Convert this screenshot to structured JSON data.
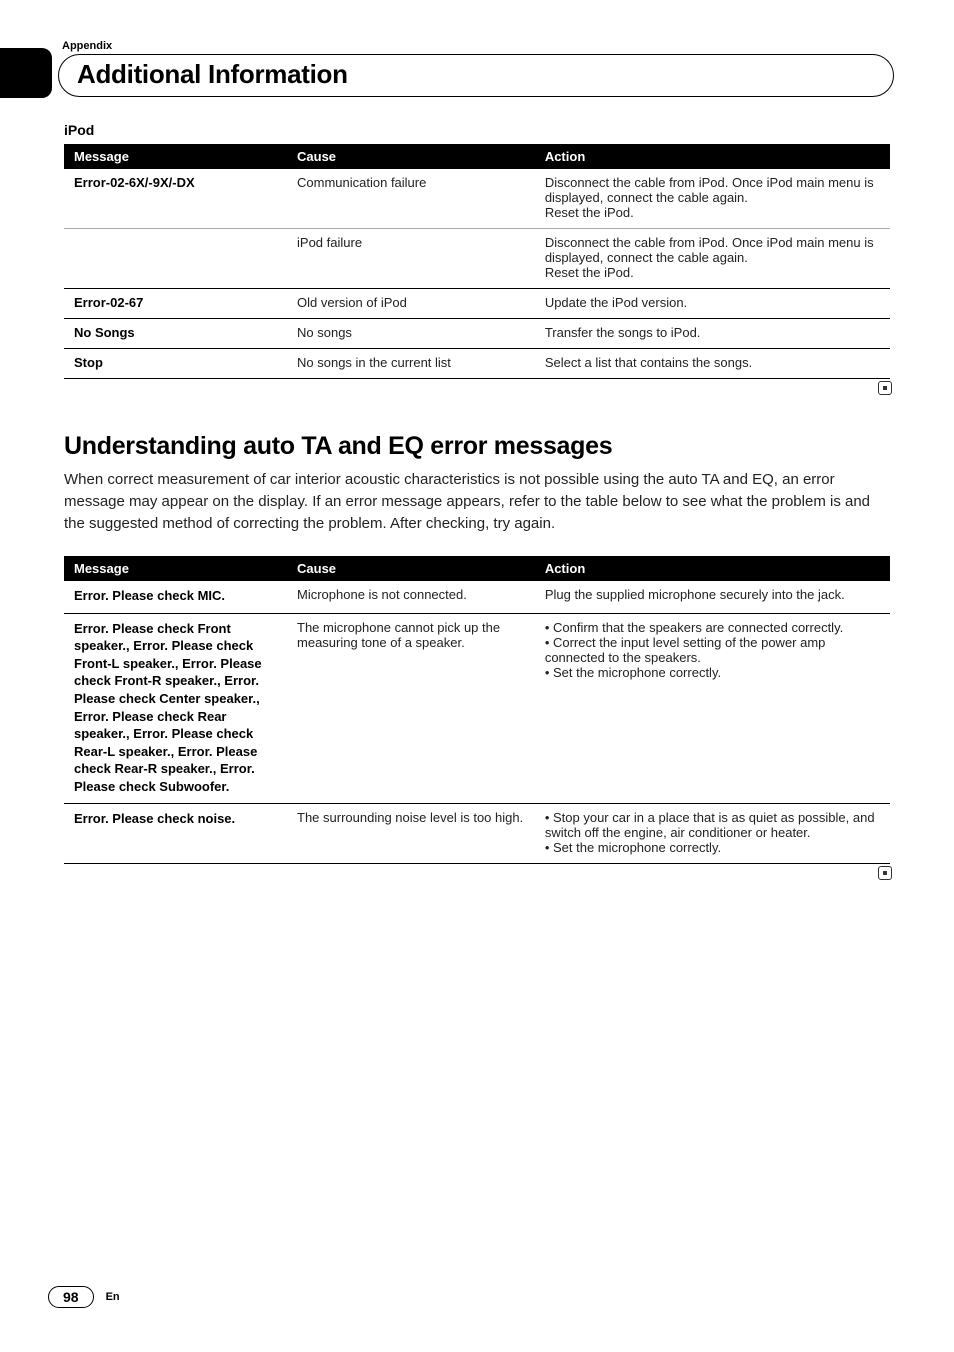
{
  "header": {
    "appendix": "Appendix",
    "title": "Additional Information"
  },
  "ipod_section": {
    "label": "iPod",
    "columns": {
      "c1": "Message",
      "c2": "Cause",
      "c3": "Action"
    },
    "rows": [
      {
        "msg": "Error-02-6X/-9X/-DX",
        "cause": "Communication failure",
        "action": "Disconnect the cable from iPod. Once iPod main menu is displayed, connect the cable again.\nReset the iPod.",
        "sep": "light"
      },
      {
        "msg": "",
        "cause": "iPod failure",
        "action": "Disconnect the cable from iPod. Once iPod main menu is displayed, connect the cable again.\nReset the iPod.",
        "sep": "solid"
      },
      {
        "msg": "Error-02-67",
        "cause": "Old version of iPod",
        "action": "Update the iPod version.",
        "sep": "solid"
      },
      {
        "msg": "No Songs",
        "cause": "No songs",
        "action": "Transfer the songs to iPod.",
        "sep": "solid"
      },
      {
        "msg": "Stop",
        "cause": "No songs in the current list",
        "action": "Select a list that contains the songs.",
        "sep": "solid"
      }
    ]
  },
  "taeq_section": {
    "heading": "Understanding auto TA and EQ error messages",
    "lead": "When correct measurement of car interior acoustic characteristics is not possible using the auto TA and EQ, an error message may appear on the display. If an error message appears, refer to the table below to see what the problem is and the suggested method of correcting the problem. After checking, try again.",
    "columns": {
      "c1": "Message",
      "c2": "Cause",
      "c3": "Action"
    },
    "rows": [
      {
        "msg": "Error. Please check MIC.",
        "cause": "Microphone is not connected.",
        "action_plain": "Plug the supplied microphone securely into the jack.",
        "sep": "solid"
      },
      {
        "msg_parts": [
          "Error. Please check Front speaker.",
          ", ",
          "Error. Please check Front-L speaker.",
          ", ",
          "Error. Please check Front-R speaker.",
          ", ",
          "Error. Please check Center speaker.",
          ", ",
          "Error. Please check Rear speaker.",
          ", ",
          "Error. Please check Rear-L speaker.",
          ", ",
          "Error. Please check Rear-R speaker.",
          ", ",
          "Error. Please check Subwoofer."
        ],
        "cause": "The microphone cannot pick up the measuring tone of a speaker.",
        "action_bullets": [
          "Confirm that the speakers are connected correctly.",
          "Correct the input level setting of the power amp connected to the speakers.",
          "Set the microphone correctly."
        ],
        "sep": "solid"
      },
      {
        "msg": "Error. Please check noise.",
        "cause": "The surrounding noise level is too high.",
        "action_bullets": [
          "Stop your car in a place that is as quiet as possible, and switch off the engine, air conditioner or heater.",
          "Set the microphone correctly."
        ],
        "sep": "solid"
      }
    ]
  },
  "footer": {
    "page": "98",
    "lang": "En"
  }
}
